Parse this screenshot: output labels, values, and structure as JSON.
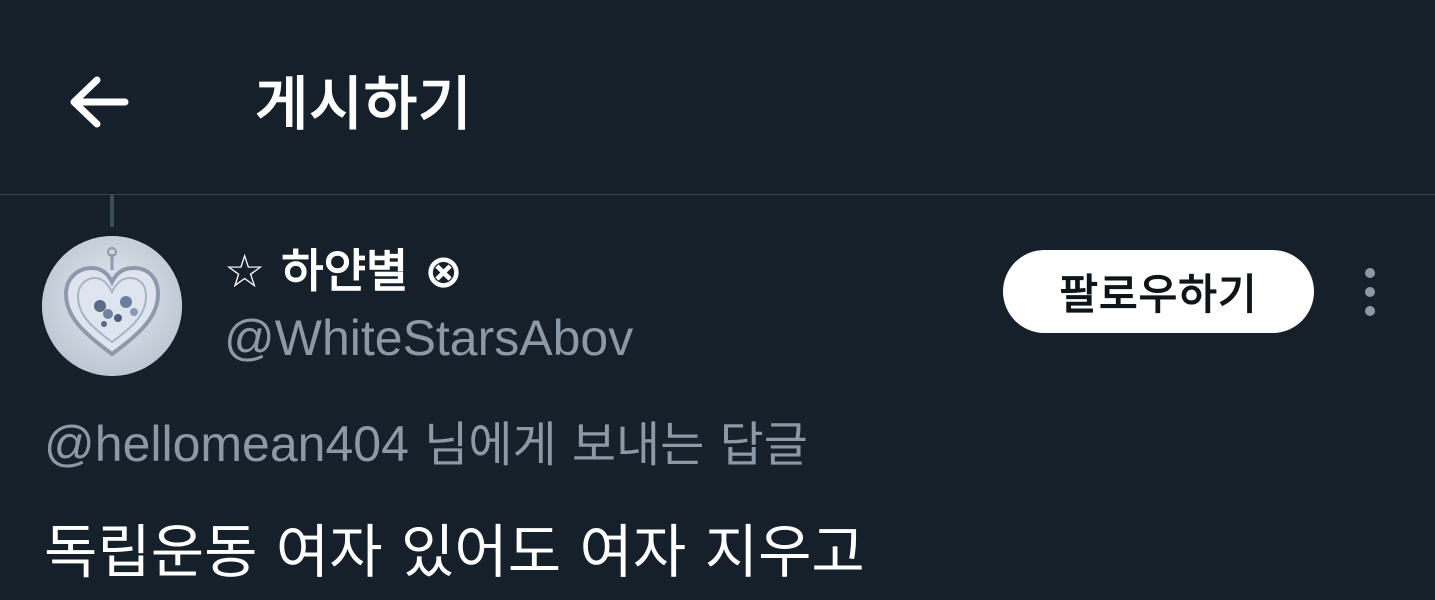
{
  "header": {
    "back_icon": "arrow-left-icon",
    "title": "게시하기"
  },
  "tweet": {
    "author": {
      "star_glyph": "☆",
      "name": "하얀별",
      "badge_glyph": "⊗",
      "handle": "@WhiteStarsAbov",
      "avatar_icon": "heart-pendant-avatar"
    },
    "follow_label": "팔로우하기",
    "more_icon": "more-vertical-icon",
    "reply_to": {
      "handle": "@hellomean404",
      "suffix": " 님에게 보내는 답글"
    },
    "text": "독립운동 여자 있어도 여자 지우고"
  },
  "colors": {
    "background": "#16202a",
    "secondary_text": "#8b98a5",
    "divider": "#38444d",
    "button_bg": "#ffffff",
    "button_text": "#0f1419"
  }
}
